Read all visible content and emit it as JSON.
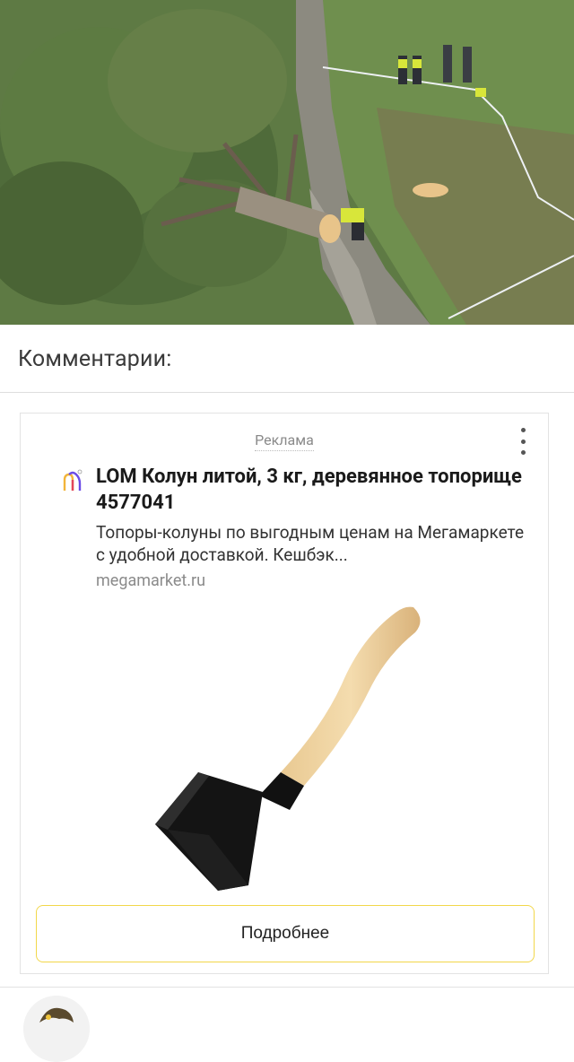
{
  "article": {
    "photo_icon": "photo-fallen-tree"
  },
  "comments": {
    "title": "Комментарии:"
  },
  "ad": {
    "label": "Реклама",
    "menu_icon": "more-vertical-icon",
    "brand_icon": "megamarket-logo",
    "title": "LOM Колун литой, 3 кг, деревянное топорище 4577041",
    "description": "Топоры-колуны по выгодным ценам на Мегамаркете с удобной доставкой. Кешбэк...",
    "domain": "megamarket.ru",
    "product_icon": "splitting-axe-image",
    "button_label": "Подробнее",
    "accent_color": "#f2d74a"
  },
  "next_comment": {
    "avatar_icon": "user-avatar"
  }
}
